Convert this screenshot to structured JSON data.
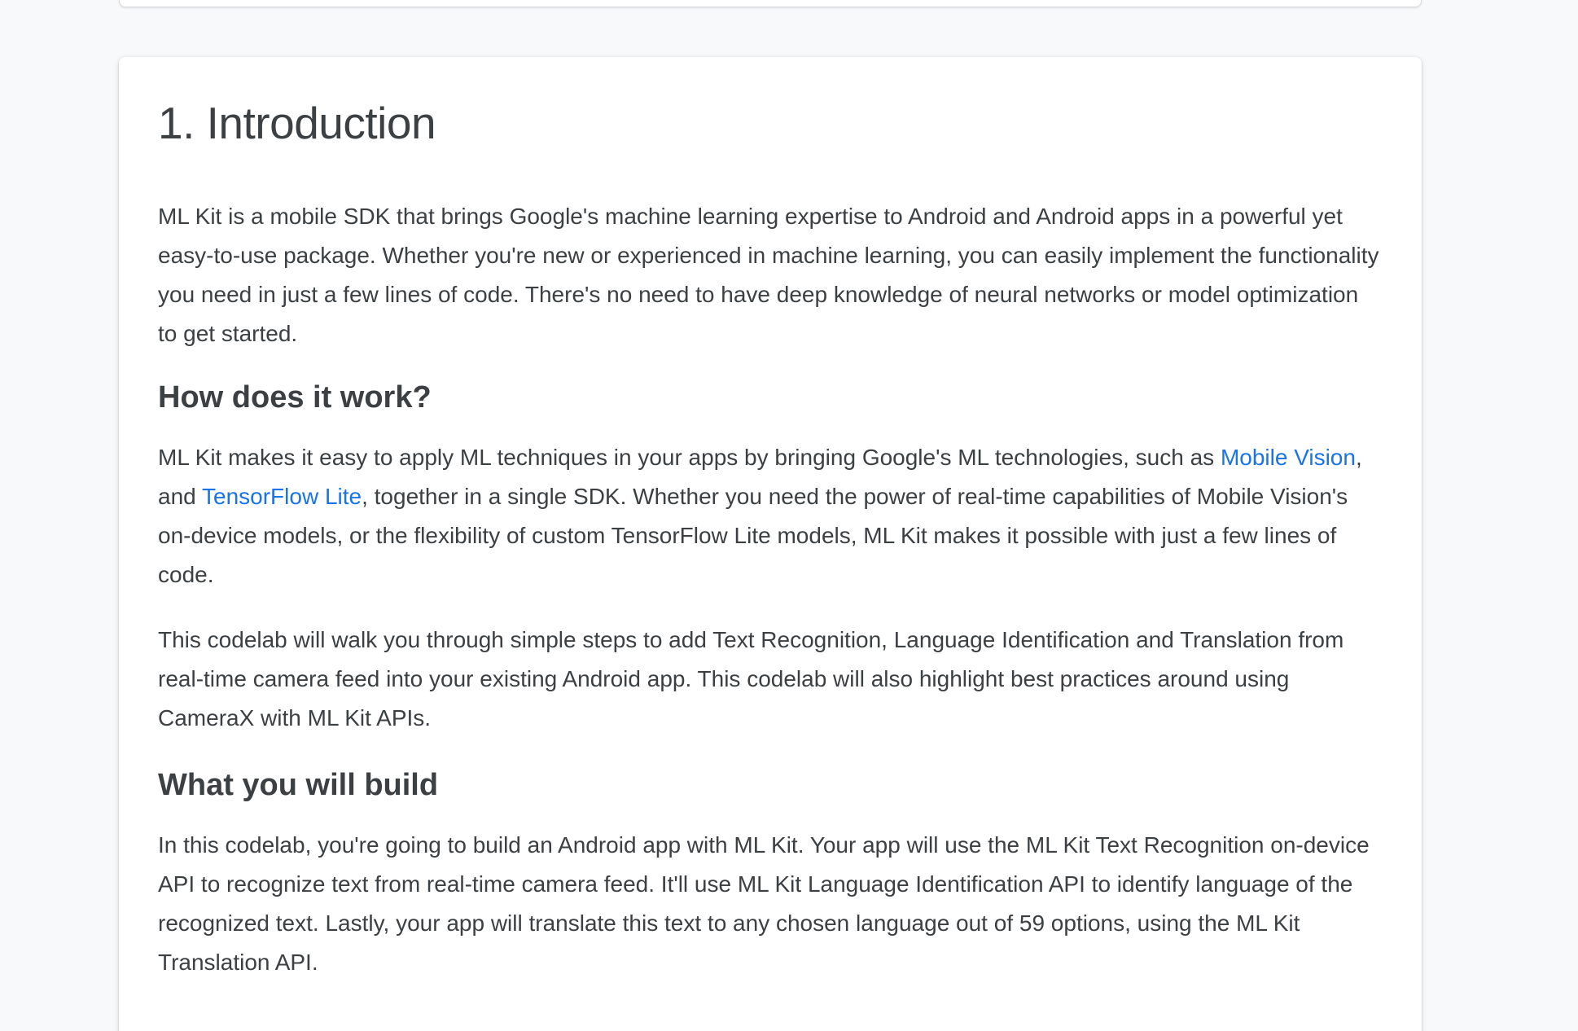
{
  "step": {
    "title": "1. Introduction"
  },
  "intro": {
    "paragraph": "ML Kit is a mobile SDK that brings Google's machine learning expertise to Android and Android apps in a powerful yet easy-to-use package. Whether you're new or experienced in machine learning, you can easily implement the functionality you need in just a few lines of code. There's no need to have deep knowledge of neural networks or model optimization to get started."
  },
  "how_it_works": {
    "heading": "How does it work?",
    "text_before_link1": "ML Kit makes it easy to apply ML techniques in your apps by bringing Google's ML technologies, such as ",
    "link1": "Mobile Vision",
    "text_between_links": ", and ",
    "link2": "TensorFlow Lite",
    "text_after_link2": ", together in a single SDK. Whether you need the power of real-time capabilities of Mobile Vision's on-device models, or the flexibility of custom TensorFlow Lite models, ML Kit makes it possible with just a few lines of code."
  },
  "codelab": {
    "paragraph": "This codelab will walk you through simple steps to add Text Recognition, Language Identification and Translation from real-time camera feed into your existing Android app. This codelab will also highlight best practices around using CameraX with ML Kit APIs."
  },
  "what_you_build": {
    "heading": "What you will build",
    "paragraph": "In this codelab, you're going to build an Android app with ML Kit. Your app will use the ML Kit Text Recognition on-device API to recognize text from real-time camera feed. It'll use ML Kit Language Identification API to identify language of the recognized text. Lastly, your app will translate this text to any chosen language out of 59 options, using the ML Kit Translation API."
  },
  "colors": {
    "text": "#3c4043",
    "link": "#1a73e8",
    "background": "#f8f9fa",
    "card": "#ffffff"
  }
}
